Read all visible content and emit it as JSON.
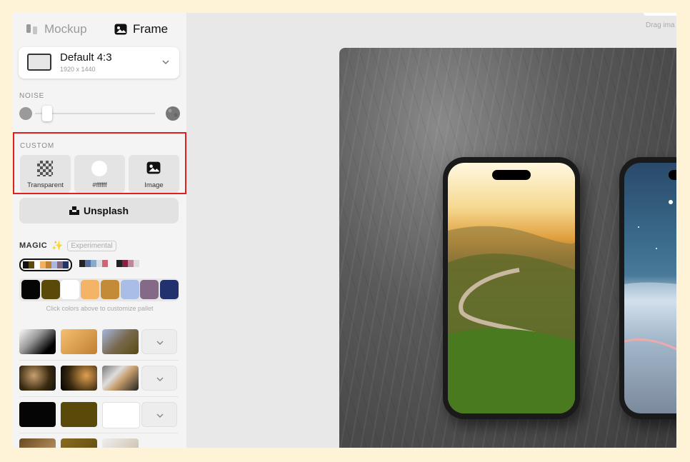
{
  "tabs": {
    "mockup": "Mockup",
    "frame": "Frame"
  },
  "frame_select": {
    "name": "Default 4:3",
    "dimensions": "1920 x 1440"
  },
  "noise": {
    "label": "NOISE",
    "value": 0.05
  },
  "custom": {
    "label": "CUSTOM",
    "options": [
      {
        "label": "Transparent",
        "icon": "checkerboard-icon"
      },
      {
        "label": "#ffffff",
        "icon": "white-circle-icon"
      },
      {
        "label": "Image",
        "icon": "image-icon"
      }
    ]
  },
  "unsplash": {
    "label": "Unsplash"
  },
  "magic": {
    "label": "MAGIC",
    "badge": "Experimental",
    "icon": "sparkles-icon"
  },
  "palettes": [
    [
      "#111111",
      "#5c4a10",
      "#ffffff",
      "#f0b060",
      "#c08030",
      "#a8b8e0",
      "#806880",
      "#223366"
    ],
    [
      "#222222",
      "#5570a0",
      "#88aacc",
      "#dddddd",
      "#cc6677"
    ],
    [
      "#222222",
      "#882244",
      "#bb8899",
      "#dddddd"
    ]
  ],
  "swatches": [
    "#050505",
    "#5a4a0a",
    "#ffffff",
    "#f3b468",
    "#c38a37",
    "#a9bde6",
    "#846a86",
    "#22326e"
  ],
  "hint": "Click colors above to customize pallet",
  "gradient_rows": [
    [
      "linear-gradient(135deg,#fafafa 0%,#999 40%,#000 80%)",
      "linear-gradient(135deg,#f5c070,#c08030)",
      "linear-gradient(135deg,#a8b8e0,#7a6a50,#5a4a10)"
    ],
    [
      "radial-gradient(circle at 40% 40%,#c8a070,#3a2a10 60%,#111)",
      "radial-gradient(circle at 70% 40%,#e0a050,#3a2a10 60%,#000)",
      "linear-gradient(135deg,#777,#ddd 35%,#c8a070 55%,#222)"
    ],
    [
      "linear-gradient(#050505,#050505)",
      "linear-gradient(#5a4a0a,#5a4a0a)",
      "linear-gradient(#ffffff,#ffffff)"
    ]
  ],
  "drag_hint": "Drag ima"
}
